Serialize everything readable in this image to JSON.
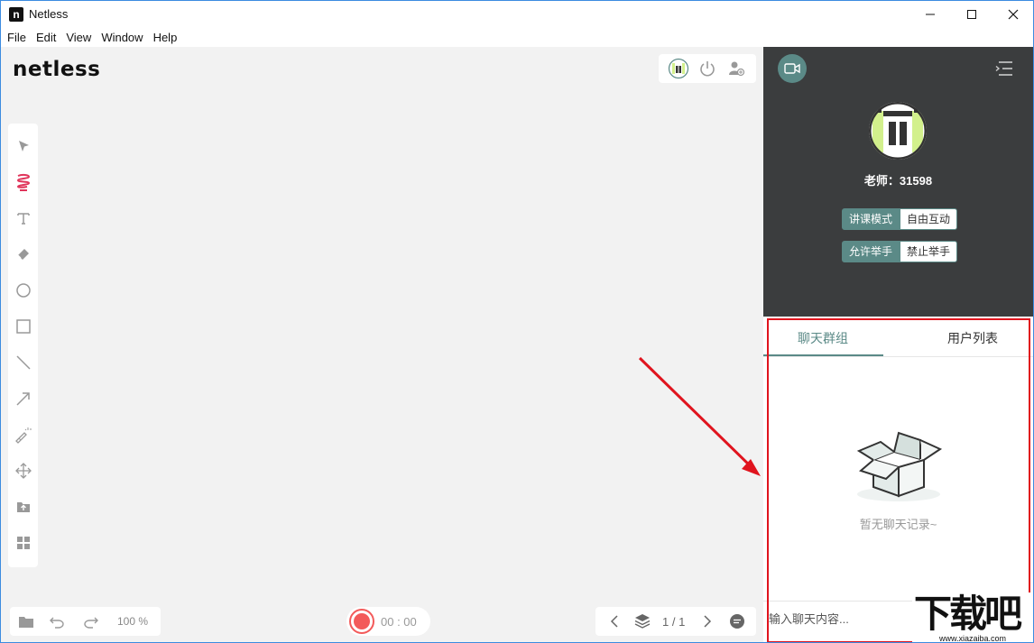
{
  "window": {
    "title": "Netless"
  },
  "menu": {
    "items": [
      "File",
      "Edit",
      "View",
      "Window",
      "Help"
    ]
  },
  "canvas": {
    "logo": "netless"
  },
  "bottom_left": {
    "zoom": "100 %"
  },
  "record": {
    "time": "00 : 00"
  },
  "pager": {
    "page": "1 / 1"
  },
  "teacher": {
    "name": "老师：31598",
    "mode_row1": {
      "active": "讲课模式",
      "inactive": "自由互动"
    },
    "mode_row2": {
      "active": "允许举手",
      "inactive": "禁止举手"
    }
  },
  "chat": {
    "tabs": [
      "聊天群组",
      "用户列表"
    ],
    "empty_text": "暂无聊天记录~",
    "input_placeholder": "输入聊天内容..."
  },
  "watermark": {
    "text": "下载吧",
    "url": "www.xiazaiba.com"
  },
  "colors": {
    "accent": "#5b8a87",
    "record": "#f35a5a",
    "highlight": "#e0141e",
    "avatar_green": "#d2f08c"
  }
}
